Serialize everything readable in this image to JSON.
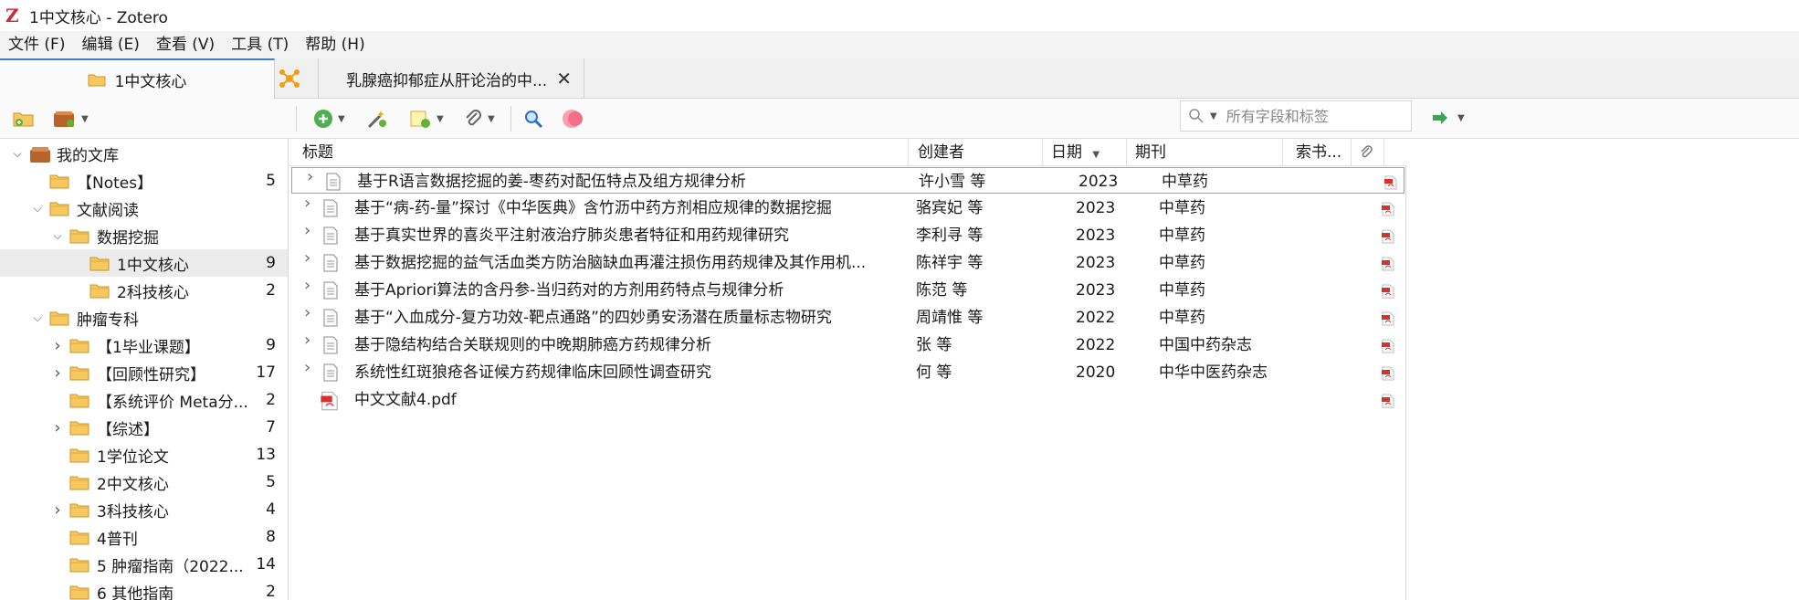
{
  "window": {
    "title": "1中文核心 - Zotero"
  },
  "menu": [
    "文件 (F)",
    "编辑 (E)",
    "查看 (V)",
    "工具 (T)",
    "帮助 (H)"
  ],
  "tabs": [
    {
      "label": "1中文核心"
    },
    {
      "label": "乳腺癌抑郁症从肝论治的中..."
    }
  ],
  "search": {
    "placeholder": "所有字段和标签"
  },
  "collections": [
    {
      "label": "我的文库",
      "count": ""
    },
    {
      "label": "【Notes】",
      "count": "5"
    },
    {
      "label": "文献阅读",
      "count": ""
    },
    {
      "label": "数据挖掘",
      "count": ""
    },
    {
      "label": "1中文核心",
      "count": "9"
    },
    {
      "label": "2科技核心",
      "count": "2"
    },
    {
      "label": "肿瘤专科",
      "count": ""
    },
    {
      "label": "【1毕业课题】",
      "count": "9"
    },
    {
      "label": "【回顾性研究】",
      "count": "17"
    },
    {
      "label": "【系统评价 Meta分...",
      "count": "2"
    },
    {
      "label": "【综述】",
      "count": "7"
    },
    {
      "label": "1学位论文",
      "count": "13"
    },
    {
      "label": "2中文核心",
      "count": "5"
    },
    {
      "label": "3科技核心",
      "count": "4"
    },
    {
      "label": "4普刊",
      "count": "8"
    },
    {
      "label": "5 肿瘤指南（2022...",
      "count": "14"
    },
    {
      "label": "6 其他指南",
      "count": "2"
    }
  ],
  "columns": {
    "title": "标题",
    "creator": "创建者",
    "date": "日期",
    "journal": "期刊",
    "callno": "索书..."
  },
  "items": [
    {
      "title": "基于R语言数据挖掘的姜-枣药对配伍特点及组方规律分析",
      "creator": "许小雪 等",
      "date": "2023",
      "journal": "中草药"
    },
    {
      "title": "基于“病-药-量”探讨《中华医典》含竹沥中药方剂相应规律的数据挖掘",
      "creator": "骆宾妃 等",
      "date": "2023",
      "journal": "中草药"
    },
    {
      "title": "基于真实世界的喜炎平注射液治疗肺炎患者特征和用药规律研究",
      "creator": "李利寻 等",
      "date": "2023",
      "journal": "中草药"
    },
    {
      "title": "基于数据挖掘的益气活血类方防治脑缺血再灌注损伤用药规律及其作用机...",
      "creator": "陈祥宇 等",
      "date": "2023",
      "journal": "中草药"
    },
    {
      "title": "基于Apriori算法的含丹参-当归药对的方剂用药特点与规律分析",
      "creator": "陈范 等",
      "date": "2023",
      "journal": "中草药"
    },
    {
      "title": "基于“入血成分-复方功效-靶点通路”的四妙勇安汤潜在质量标志物研究",
      "creator": "周靖惟 等",
      "date": "2022",
      "journal": "中草药"
    },
    {
      "title": "基于隐结构结合关联规则的中晚期肺癌方药规律分析",
      "creator": "张 等",
      "date": "2022",
      "journal": "中国中药杂志"
    },
    {
      "title": "系统性红斑狼疮各证候方药规律临床回顾性调查研究",
      "creator": "何 等",
      "date": "2020",
      "journal": "中华中医药杂志"
    },
    {
      "title": "中文文献4.pdf",
      "creator": "",
      "date": "",
      "journal": ""
    }
  ]
}
